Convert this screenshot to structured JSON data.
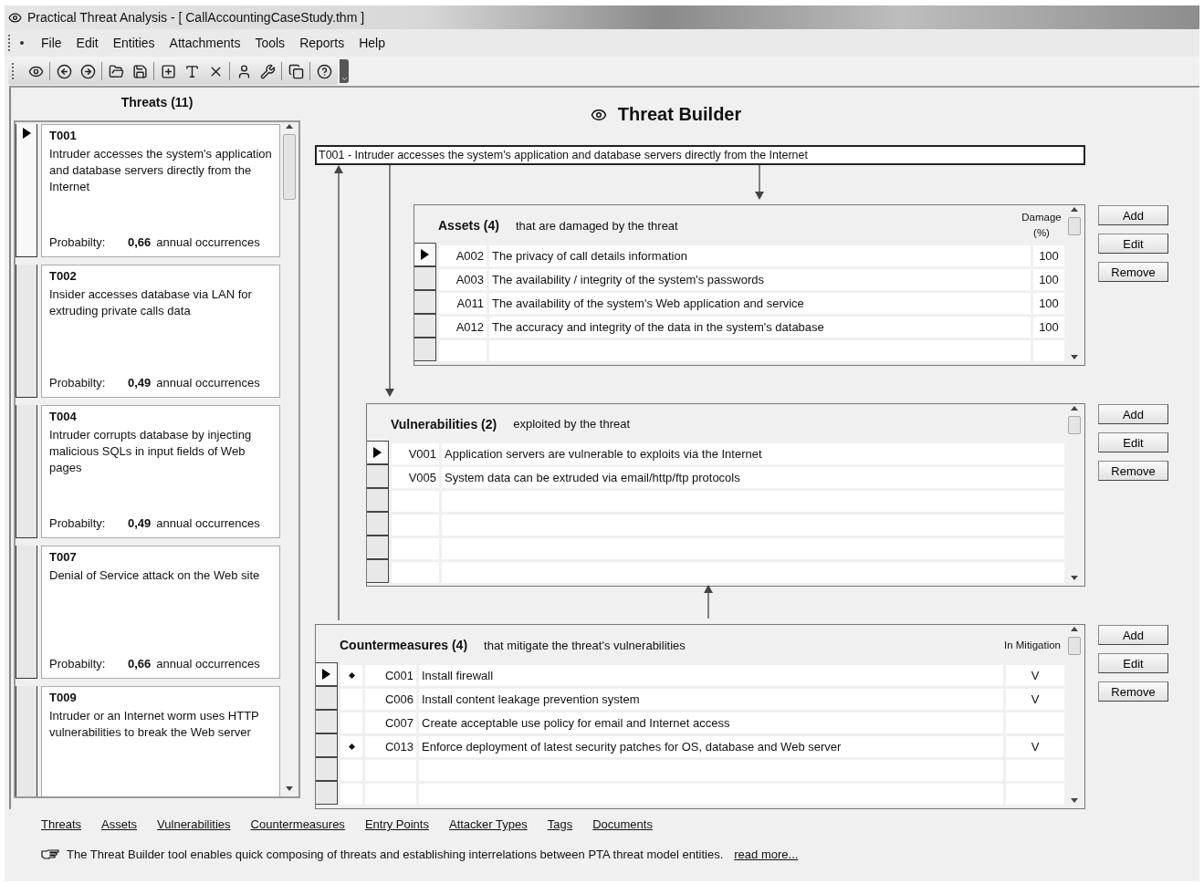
{
  "window": {
    "title": "Practical Threat Analysis - [ CallAccountingCaseStudy.thm ]"
  },
  "menu": [
    "File",
    "Edit",
    "Entities",
    "Attachments",
    "Tools",
    "Reports",
    "Help"
  ],
  "threats": {
    "title": "Threats (11)",
    "items": [
      {
        "id": "T001",
        "description": "Intruder accesses the system's application and database servers directly from the Internet",
        "probability_label": "Probabilty:",
        "probability": "0,66",
        "unit": "annual occurrences",
        "selected": true
      },
      {
        "id": "T002",
        "description": "Insider accesses database via LAN for extruding private calls data",
        "probability_label": "Probabilty:",
        "probability": "0,49",
        "unit": "annual occurrences",
        "selected": false
      },
      {
        "id": "T004",
        "description": "Intruder corrupts database by injecting malicious SQLs in input fields of  Web pages",
        "probability_label": "Probabilty:",
        "probability": "0,49",
        "unit": "annual occurrences",
        "selected": false
      },
      {
        "id": "T007",
        "description": "Denial of Service attack on the Web site",
        "probability_label": "Probabilty:",
        "probability": "0,66",
        "unit": "annual occurrences",
        "selected": false
      },
      {
        "id": "T009",
        "description": "Intruder or an Internet worm uses HTTP vulnerabilities to break the Web server",
        "selected": false
      }
    ]
  },
  "builder": {
    "title": "Threat Builder",
    "threat": "T001 - Intruder accesses the system's application and database servers directly from the Internet",
    "assets": {
      "title": "Assets (4)",
      "subtitle": "that are damaged by the threat",
      "value_column": "Damage (%)",
      "buttons": [
        "Add",
        "Edit",
        "Remove"
      ],
      "rows": [
        {
          "id": "A002",
          "description": "The privacy of call details information",
          "value": "100",
          "selected": true
        },
        {
          "id": "A003",
          "description": "The availability / integrity of the system's passwords",
          "value": "100",
          "selected": false
        },
        {
          "id": "A011",
          "description": "The availability of the system's Web application and service",
          "value": "100",
          "selected": false
        },
        {
          "id": "A012",
          "description": "The accuracy and integrity of the data in the system's database",
          "value": "100",
          "selected": false
        }
      ]
    },
    "vulnerabilities": {
      "title": "Vulnerabilities (2)",
      "subtitle": "exploited by the threat",
      "buttons": [
        "Add",
        "Edit",
        "Remove"
      ],
      "rows": [
        {
          "id": "V001",
          "description": "Application servers are vulnerable to exploits via the Internet",
          "selected": true
        },
        {
          "id": "V005",
          "description": "System data can be extruded via email/http/ftp protocols",
          "selected": false
        }
      ]
    },
    "countermeasures": {
      "title": "Countermeasures (4)",
      "subtitle": "that mitigate the threat's vulnerabilities",
      "value_column": "In Mitigation",
      "buttons": [
        "Add",
        "Edit",
        "Remove"
      ],
      "rows": [
        {
          "id": "C001",
          "description": "Install firewall",
          "value": "V",
          "marked": true,
          "selected": true
        },
        {
          "id": "C006",
          "description": "Install content leakage prevention system",
          "value": "V",
          "marked": false,
          "selected": false
        },
        {
          "id": "C007",
          "description": "Create acceptable use policy for email and Internet access",
          "marked": false,
          "selected": false
        },
        {
          "id": "C013",
          "description": "Enforce deployment of latest security patches for OS, database and Web server",
          "value": "V",
          "marked": true,
          "selected": false
        }
      ]
    }
  },
  "links": [
    "Threats",
    "Assets",
    "Vulnerabilities",
    "Countermeasures",
    "Entry Points",
    "Attacker Types",
    "Tags",
    "Documents"
  ],
  "info": {
    "text": "The Threat Builder tool enables quick composing of threats and establishing interrelations between PTA threat model entities.",
    "link": "read more..."
  }
}
